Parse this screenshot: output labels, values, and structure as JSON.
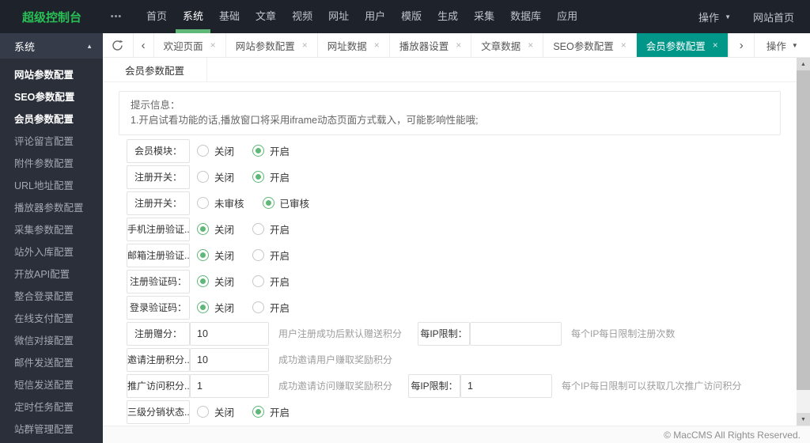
{
  "topbar": {
    "brand": "超级控制台",
    "nav": [
      {
        "label": "首页",
        "active": false
      },
      {
        "label": "系统",
        "active": true
      },
      {
        "label": "基础",
        "active": false
      },
      {
        "label": "文章",
        "active": false
      },
      {
        "label": "视频",
        "active": false
      },
      {
        "label": "网址",
        "active": false
      },
      {
        "label": "用户",
        "active": false
      },
      {
        "label": "模版",
        "active": false
      },
      {
        "label": "生成",
        "active": false
      },
      {
        "label": "采集",
        "active": false
      },
      {
        "label": "数据库",
        "active": false
      },
      {
        "label": "应用",
        "active": false
      }
    ],
    "action_label": "操作",
    "home_label": "网站首页"
  },
  "sidebar": {
    "title": "系统",
    "items": [
      {
        "label": "网站参数配置",
        "active": true
      },
      {
        "label": "SEO参数配置",
        "active": true
      },
      {
        "label": "会员参数配置",
        "active": true
      },
      {
        "label": "评论留言配置",
        "active": false
      },
      {
        "label": "附件参数配置",
        "active": false
      },
      {
        "label": "URL地址配置",
        "active": false
      },
      {
        "label": "播放器参数配置",
        "active": false
      },
      {
        "label": "采集参数配置",
        "active": false
      },
      {
        "label": "站外入库配置",
        "active": false
      },
      {
        "label": "开放API配置",
        "active": false
      },
      {
        "label": "整合登录配置",
        "active": false
      },
      {
        "label": "在线支付配置",
        "active": false
      },
      {
        "label": "微信对接配置",
        "active": false
      },
      {
        "label": "邮件发送配置",
        "active": false
      },
      {
        "label": "短信发送配置",
        "active": false
      },
      {
        "label": "定时任务配置",
        "active": false
      },
      {
        "label": "站群管理配置",
        "active": false
      }
    ]
  },
  "tabbar": {
    "tabs": [
      {
        "label": "欢迎页面",
        "active": false
      },
      {
        "label": "网站参数配置",
        "active": false
      },
      {
        "label": "网址数据",
        "active": false
      },
      {
        "label": "播放器设置",
        "active": false
      },
      {
        "label": "文章数据",
        "active": false
      },
      {
        "label": "SEO参数配置",
        "active": false
      },
      {
        "label": "会员参数配置",
        "active": true
      }
    ],
    "ops_label": "操作"
  },
  "content": {
    "page_tab": "会员参数配置",
    "notice": {
      "title": "提示信息：",
      "line": "1.开启试看功能的话,播放窗口将采用iframe动态页面方式载入，可能影响性能哦;"
    },
    "form_rows": [
      {
        "label": "会员模块：",
        "control": "radio",
        "options": [
          {
            "label": "关闭",
            "selected": false
          },
          {
            "label": "开启",
            "selected": true
          }
        ]
      },
      {
        "label": "注册开关：",
        "control": "radio",
        "options": [
          {
            "label": "关闭",
            "selected": false
          },
          {
            "label": "开启",
            "selected": true
          }
        ]
      },
      {
        "label": "注册开关：",
        "control": "radio",
        "options": [
          {
            "label": "未审核",
            "selected": false
          },
          {
            "label": "已审核",
            "selected": true
          }
        ]
      },
      {
        "label": "手机注册验证...",
        "control": "radio",
        "options": [
          {
            "label": "关闭",
            "selected": true
          },
          {
            "label": "开启",
            "selected": false
          }
        ]
      },
      {
        "label": "邮箱注册验证...",
        "control": "radio",
        "options": [
          {
            "label": "关闭",
            "selected": true
          },
          {
            "label": "开启",
            "selected": false
          }
        ]
      },
      {
        "label": "注册验证码：",
        "control": "radio",
        "options": [
          {
            "label": "关闭",
            "selected": true
          },
          {
            "label": "开启",
            "selected": false
          }
        ]
      },
      {
        "label": "登录验证码：",
        "control": "radio",
        "options": [
          {
            "label": "关闭",
            "selected": true
          },
          {
            "label": "开启",
            "selected": false
          }
        ]
      },
      {
        "label": "注册赠分：",
        "control": "input",
        "value": "10",
        "hint": "用户注册成功后默认赠送积分",
        "extra": {
          "label": "每IP限制：",
          "value": "",
          "hint": "每个IP每日限制注册次数"
        }
      },
      {
        "label": "邀请注册积分...",
        "control": "input",
        "value": "10",
        "hint": "成功邀请用户赚取奖励积分"
      },
      {
        "label": "推广访问积分...",
        "control": "input",
        "value": "1",
        "hint": "成功邀请访问赚取奖励积分",
        "extra": {
          "label": "每IP限制：",
          "value": "1",
          "hint": "每个IP每日限制可以获取几次推广访问积分"
        }
      },
      {
        "label": "三级分销状态...",
        "control": "radio",
        "options": [
          {
            "label": "关闭",
            "selected": false
          },
          {
            "label": "开启",
            "selected": true
          }
        ]
      }
    ]
  },
  "footer": {
    "copyright": "© MacCMS All Rights Reserved."
  },
  "icons": {
    "menu_dots": "•••",
    "caret_down": "▼",
    "collapse_up": "▲",
    "tab_prev": "‹",
    "tab_next": "›",
    "tab_close": "×",
    "scroll_up": "▲",
    "scroll_down": "▼"
  },
  "colors": {
    "accent_teal": "#009688",
    "radio_green": "#5FB878",
    "nav_underline_green": "#5FB878",
    "brand_green": "#28be55",
    "topbar_bg": "#1e222a",
    "sidebar_bg": "#2b2f3a"
  }
}
